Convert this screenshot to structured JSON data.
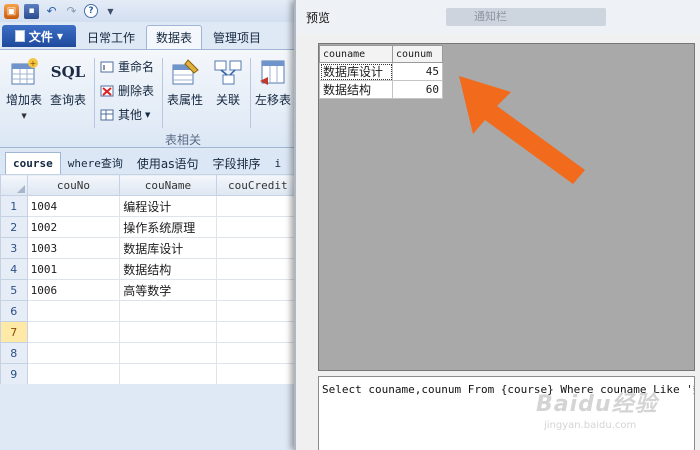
{
  "quick_access": {
    "icons": [
      "app-icon",
      "save-icon",
      "undo-icon",
      "redo-icon",
      "help-icon",
      "customize-icon"
    ]
  },
  "ribbon_tabs": {
    "file": "文件",
    "tabs": [
      "日常工作",
      "数据表",
      "管理项目"
    ],
    "active": "数据表"
  },
  "ribbon": {
    "add_table": "增加表",
    "query_table": "查询表",
    "query_icon_text": "SQL",
    "rename": "重命名",
    "delete_table": "删除表",
    "other": "其他",
    "table_props": "表属性",
    "relations": "关联",
    "move_left": "左移表",
    "group_label": "表相关"
  },
  "subtabs": [
    "course",
    "where查询",
    "使用as语句",
    "字段排序",
    "i"
  ],
  "grid": {
    "columns": [
      "couNo",
      "couName",
      "couCredit"
    ],
    "rows": [
      {
        "n": "1",
        "couNo": "1004",
        "couName": "编程设计"
      },
      {
        "n": "2",
        "couNo": "1002",
        "couName": "操作系统原理"
      },
      {
        "n": "3",
        "couNo": "1003",
        "couName": "数据库设计"
      },
      {
        "n": "4",
        "couNo": "1001",
        "couName": "数据结构"
      },
      {
        "n": "5",
        "couNo": "1006",
        "couName": "高等数学"
      },
      {
        "n": "6",
        "couNo": "",
        "couName": ""
      },
      {
        "n": "7",
        "couNo": "",
        "couName": ""
      },
      {
        "n": "8",
        "couNo": "",
        "couName": ""
      },
      {
        "n": "9",
        "couNo": "",
        "couName": ""
      }
    ],
    "selected_row": "7"
  },
  "preview": {
    "title": "预览",
    "background_title": "通知栏",
    "result_columns": [
      "couname",
      "counum"
    ],
    "result_rows": [
      {
        "couname": "数据库设计",
        "counum": "45"
      },
      {
        "couname": "数据结构",
        "counum": "60"
      }
    ],
    "sql": "Select couname,counum From {course} Where couname Like '数%'",
    "arrow_color": "#f26a1b"
  },
  "watermark": {
    "line1": "Baidu经验",
    "line2": "jingyan.baidu.com"
  }
}
